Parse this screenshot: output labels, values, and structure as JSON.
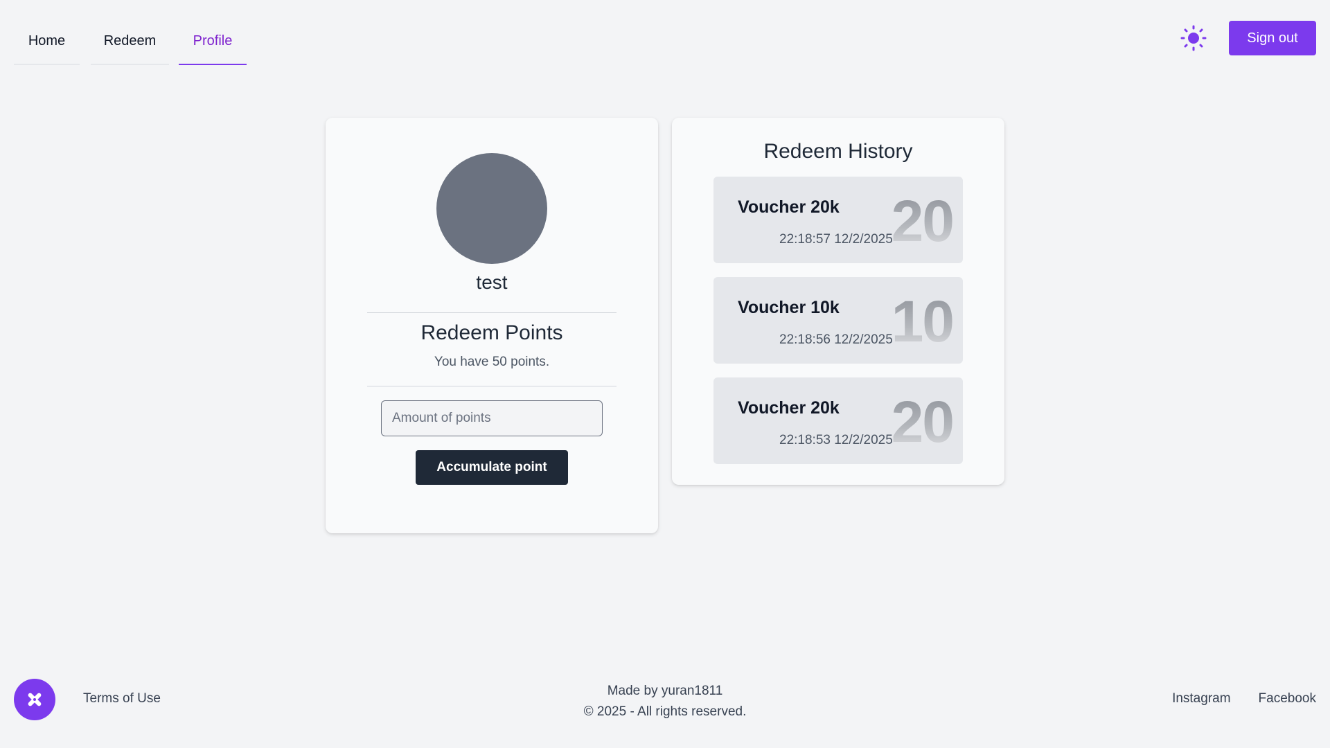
{
  "nav": {
    "tabs": [
      {
        "label": "Home"
      },
      {
        "label": "Redeem"
      },
      {
        "label": "Profile"
      }
    ],
    "active_tab": "Profile",
    "theme_icon": "sun-icon",
    "sign_out_label": "Sign out"
  },
  "colors": {
    "accent": "#7c3aed",
    "dark_button": "#1f2937",
    "avatar": "#6b7280"
  },
  "profile": {
    "username": "test",
    "section_title": "Redeem Points",
    "points_text": "You have 50 points.",
    "input_placeholder": "Amount of points",
    "input_value": "",
    "button_label": "Accumulate point"
  },
  "history": {
    "title": "Redeem History",
    "items": [
      {
        "name": "Voucher 20k",
        "big": "20",
        "time": "22:18:57 12/2/2025"
      },
      {
        "name": "Voucher 10k",
        "big": "10",
        "time": "22:18:56 12/2/2025"
      },
      {
        "name": "Voucher 20k",
        "big": "20",
        "time": "22:18:53 12/2/2025"
      }
    ]
  },
  "footer": {
    "logo_icon": "brand-logo-icon",
    "terms": "Terms of Use",
    "made_by": "Made by yuran1811",
    "copyright": "© 2025 - All rights reserved.",
    "links": [
      "Instagram",
      "Facebook"
    ]
  }
}
